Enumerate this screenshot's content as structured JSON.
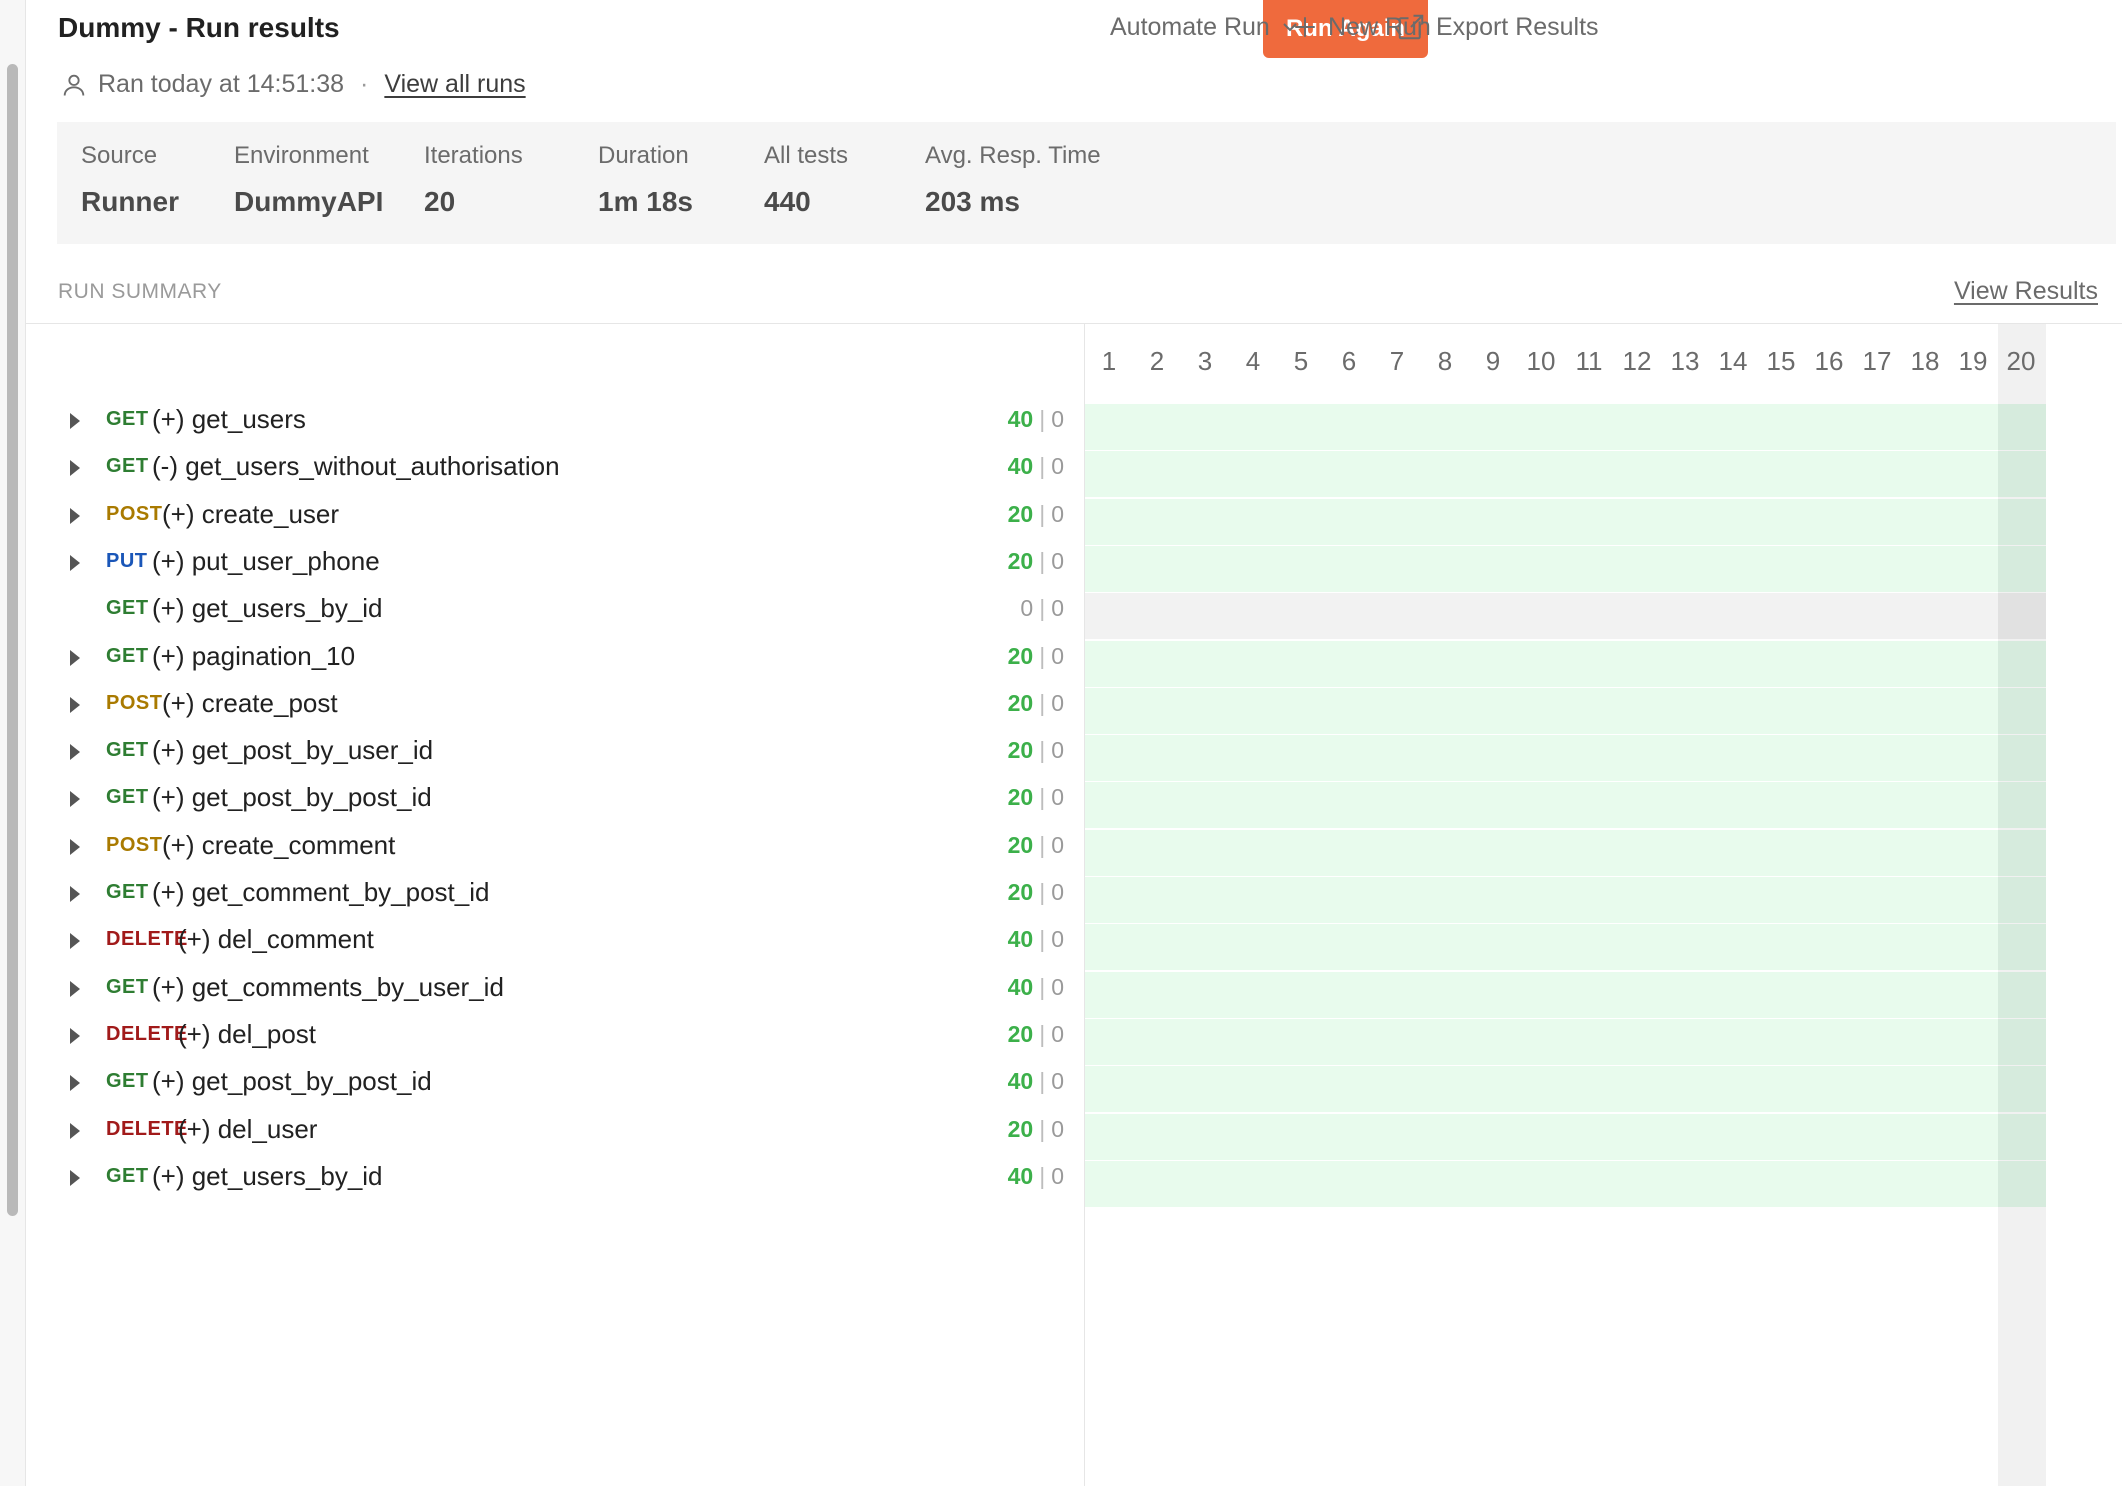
{
  "header": {
    "title": "Dummy - Run results",
    "ran_text": "Ran today at 14:51:38",
    "separator": "·",
    "view_all_runs": "View all runs",
    "run_again": "Run Again",
    "automate_run": "Automate Run",
    "new_run": "New Run",
    "export_results": "Export Results"
  },
  "stats": [
    {
      "label": "Source",
      "value": "Runner"
    },
    {
      "label": "Environment",
      "value": "DummyAPI"
    },
    {
      "label": "Iterations",
      "value": "20"
    },
    {
      "label": "Duration",
      "value": "1m 18s"
    },
    {
      "label": "All tests",
      "value": "440"
    },
    {
      "label": "Avg. Resp. Time",
      "value": "203 ms"
    }
  ],
  "summary": {
    "label": "RUN SUMMARY",
    "view_results": "View Results",
    "iterations": [
      "1",
      "2",
      "3",
      "4",
      "5",
      "6",
      "7",
      "8",
      "9",
      "10",
      "11",
      "12",
      "13",
      "14",
      "15",
      "16",
      "17",
      "18",
      "19",
      "20"
    ],
    "selected_iteration": "20"
  },
  "requests": [
    {
      "method": "GET",
      "name": "(+) get_users",
      "passed": "40",
      "failed": "0",
      "expandable": true
    },
    {
      "method": "GET",
      "name": "(-) get_users_without_authorisation",
      "passed": "40",
      "failed": "0",
      "expandable": true
    },
    {
      "method": "POST",
      "name": "(+) create_user",
      "passed": "20",
      "failed": "0",
      "expandable": true
    },
    {
      "method": "PUT",
      "name": "(+) put_user_phone",
      "passed": "20",
      "failed": "0",
      "expandable": true
    },
    {
      "method": "GET",
      "name": "(+) get_users_by_id",
      "passed": "0",
      "failed": "0",
      "expandable": false
    },
    {
      "method": "GET",
      "name": "(+) pagination_10",
      "passed": "20",
      "failed": "0",
      "expandable": true
    },
    {
      "method": "POST",
      "name": "(+) create_post",
      "passed": "20",
      "failed": "0",
      "expandable": true
    },
    {
      "method": "GET",
      "name": "(+) get_post_by_user_id",
      "passed": "20",
      "failed": "0",
      "expandable": true
    },
    {
      "method": "GET",
      "name": "(+) get_post_by_post_id",
      "passed": "20",
      "failed": "0",
      "expandable": true
    },
    {
      "method": "POST",
      "name": "(+) create_comment",
      "passed": "20",
      "failed": "0",
      "expandable": true
    },
    {
      "method": "GET",
      "name": "(+) get_comment_by_post_id",
      "passed": "20",
      "failed": "0",
      "expandable": true
    },
    {
      "method": "DELETE",
      "name": "(+) del_comment",
      "passed": "40",
      "failed": "0",
      "expandable": true
    },
    {
      "method": "GET",
      "name": "(+) get_comments_by_user_id",
      "passed": "40",
      "failed": "0",
      "expandable": true
    },
    {
      "method": "DELETE",
      "name": "(+) del_post",
      "passed": "20",
      "failed": "0",
      "expandable": true
    },
    {
      "method": "GET",
      "name": "(+) get_post_by_post_id",
      "passed": "40",
      "failed": "0",
      "expandable": true
    },
    {
      "method": "DELETE",
      "name": "(+) del_user",
      "passed": "20",
      "failed": "0",
      "expandable": true
    },
    {
      "method": "GET",
      "name": "(+) get_users_by_id",
      "passed": "40",
      "failed": "0",
      "expandable": true
    }
  ],
  "colors": {
    "accent": "#ef6a3d",
    "pass": "#3cb04a",
    "get": "#2e7d32",
    "post": "#a97a00",
    "put": "#1a56b8",
    "delete": "#a11a1a"
  }
}
